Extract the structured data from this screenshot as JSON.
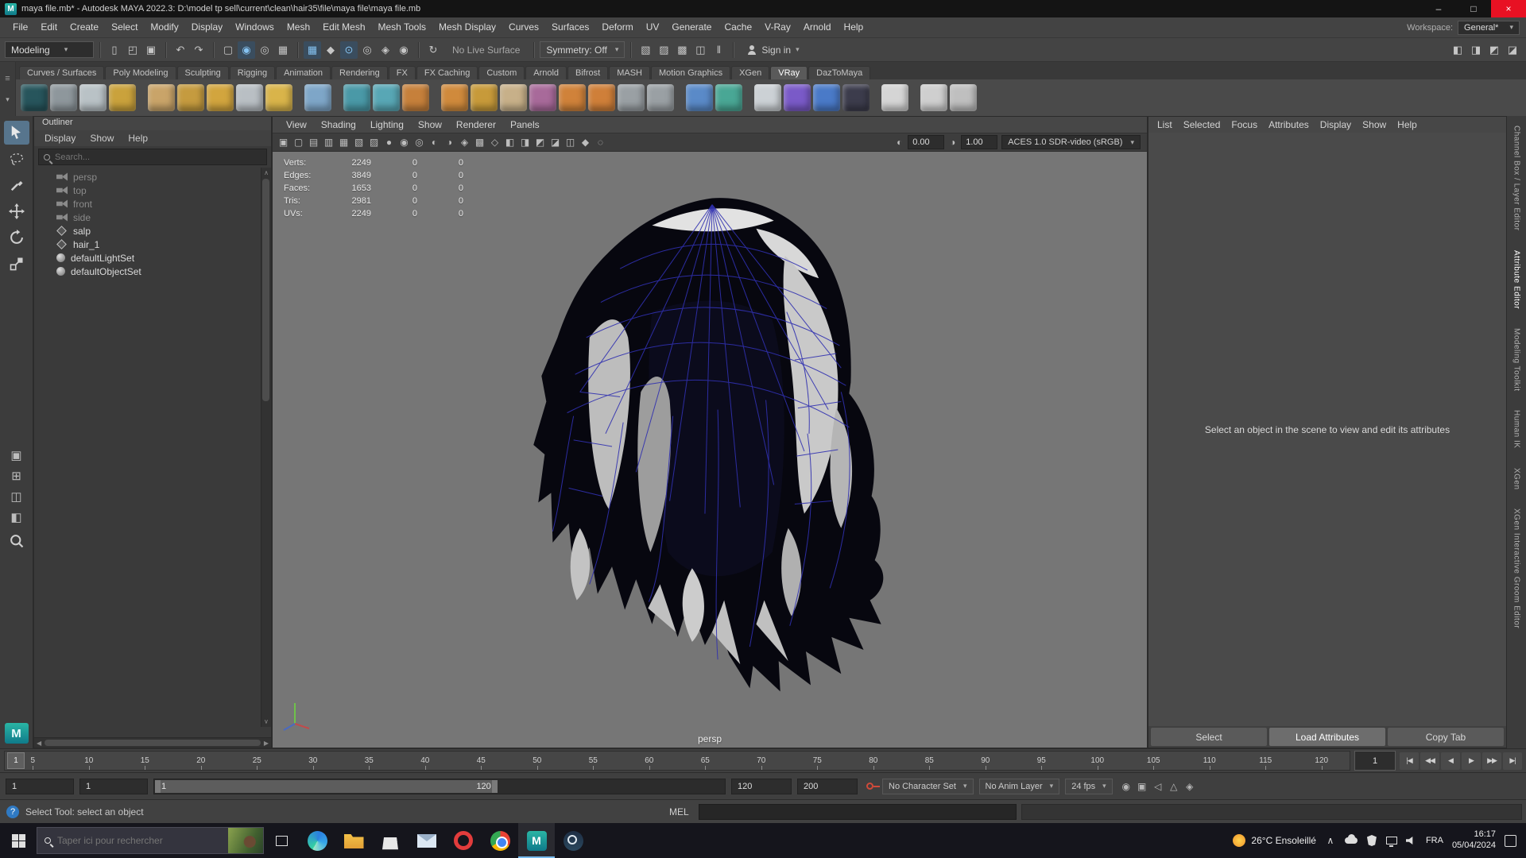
{
  "icons": {
    "chevron": "▾",
    "minimize": "–",
    "maximize": "□",
    "close": "×",
    "question": "?",
    "hamburger": "≡",
    "left_arrow": "◀",
    "right_arrow": "▶",
    "up_arrow": "∧"
  },
  "window": {
    "title": "maya file.mb* - Autodesk MAYA 2022.3: D:\\model tp sell\\current\\clean\\hair35\\file\\maya file\\maya file.mb"
  },
  "menu_bar": {
    "items": [
      "File",
      "Edit",
      "Create",
      "Select",
      "Modify",
      "Display",
      "Windows",
      "Mesh",
      "Edit Mesh",
      "Mesh Tools",
      "Mesh Display",
      "Curves",
      "Surfaces",
      "Deform",
      "UV",
      "Generate",
      "Cache",
      "V-Ray",
      "Arnold",
      "Help"
    ],
    "workspace_label": "Workspace:",
    "workspace_value": "General*"
  },
  "status_line": {
    "mode": "Modeling",
    "file_icons": [
      {
        "name": "new-scene-icon",
        "glyph": "▯"
      },
      {
        "name": "open-scene-icon",
        "glyph": "◰"
      },
      {
        "name": "save-scene-icon",
        "glyph": "▣"
      }
    ],
    "edit_icons": [
      {
        "name": "undo-icon",
        "glyph": "↶"
      },
      {
        "name": "redo-icon",
        "glyph": "↷"
      }
    ],
    "select_icons": [
      {
        "name": "select-hierarchy-icon",
        "glyph": "▢"
      },
      {
        "name": "select-object-icon",
        "glyph": "◉",
        "cls": "on"
      },
      {
        "name": "select-component-icon",
        "glyph": "◎"
      },
      {
        "name": "highlight-selection-icon",
        "glyph": "▦"
      }
    ],
    "snap_icons": [
      {
        "name": "snap-grid-icon",
        "glyph": "▦",
        "cls": "on"
      },
      {
        "name": "snap-curve-icon",
        "glyph": "◆"
      },
      {
        "name": "snap-point-icon",
        "glyph": "⊙",
        "cls": "on"
      },
      {
        "name": "snap-projected-center-icon",
        "glyph": "◎"
      },
      {
        "name": "snap-view-plane-icon",
        "glyph": "◈"
      },
      {
        "name": "make-live-icon",
        "glyph": "◉"
      }
    ],
    "history_icons": [
      {
        "name": "construction-history-icon",
        "glyph": "↻"
      }
    ],
    "no_live_surface": "No Live Surface",
    "symmetry": "Symmetry: Off",
    "render_icons": [
      {
        "name": "open-render-view-icon",
        "glyph": "▧"
      },
      {
        "name": "render-current-frame-icon",
        "glyph": "▨"
      },
      {
        "name": "ipr-render-icon",
        "glyph": "▩"
      },
      {
        "name": "render-settings-icon",
        "glyph": "◫"
      },
      {
        "name": "pause-viewport-icon",
        "glyph": "‖"
      }
    ],
    "sign_in": "Sign in",
    "ui_toggle_icons": [
      {
        "name": "single-pane-toggle-icon",
        "glyph": "◧"
      },
      {
        "name": "panel-layout-toggle-icon",
        "glyph": "◨"
      },
      {
        "name": "channel-box-toggle-icon",
        "glyph": "◩"
      },
      {
        "name": "attribute-editor-toggle-icon",
        "glyph": "◪"
      }
    ]
  },
  "shelf": {
    "tabs": [
      {
        "label": "Curves / Surfaces"
      },
      {
        "label": "Poly Modeling"
      },
      {
        "label": "Sculpting"
      },
      {
        "label": "Rigging"
      },
      {
        "label": "Animation"
      },
      {
        "label": "Rendering"
      },
      {
        "label": "FX"
      },
      {
        "label": "FX Caching"
      },
      {
        "label": "Custom"
      },
      {
        "label": "Arnold"
      },
      {
        "label": "Bifrost"
      },
      {
        "label": "MASH"
      },
      {
        "label": "Motion Graphics"
      },
      {
        "label": "XGen"
      },
      {
        "label": "VRay",
        "cls": "active"
      },
      {
        "label": "DazToMaya"
      }
    ],
    "icons": [
      {
        "name": "vray-sphere-dark-icon",
        "bg": "#27555c"
      },
      {
        "name": "vray-sphere-gray-icon",
        "bg": "#8e979c"
      },
      {
        "name": "vray-sphere-light-icon",
        "bg": "#b9c2c6"
      },
      {
        "name": "gold-lamp-icon",
        "bg": "#caa23c"
      },
      {
        "cls": "gap"
      },
      {
        "name": "umbrella-icon",
        "bg": "#c9a469"
      },
      {
        "name": "hammer-icon",
        "bg": "#c59b3f"
      },
      {
        "name": "gold-sphere-icon",
        "bg": "#d2a53e"
      },
      {
        "name": "atom-icon",
        "bg": "#b9bfc4"
      },
      {
        "name": "star-icon",
        "bg": "#d9b44a"
      },
      {
        "cls": "gap"
      },
      {
        "name": "glass-pane-icon",
        "bg": "#7ea6c8"
      },
      {
        "cls": "gap"
      },
      {
        "name": "export-proxy-icon",
        "bg": "#4a99a7"
      },
      {
        "name": "import-proxy-icon",
        "bg": "#58a7b5"
      },
      {
        "name": "scene-export-icon",
        "bg": "#c6803b"
      },
      {
        "cls": "gap"
      },
      {
        "name": "fur-icon",
        "bg": "#d08a3c"
      },
      {
        "name": "trident-icon",
        "bg": "#c79a3a"
      },
      {
        "name": "interactive-hand-icon",
        "bg": "#c7b089"
      },
      {
        "name": "texture-grid-icon",
        "bg": "#a86a9a"
      },
      {
        "name": "checker-icon",
        "bg": "#d0823a"
      },
      {
        "name": "orange-sphere-icon",
        "bg": "#cf7f39"
      },
      {
        "name": "rig-person-icon",
        "bg": "#9aa0a4"
      },
      {
        "name": "gear-icon",
        "bg": "#9aa0a4"
      },
      {
        "cls": "gap"
      },
      {
        "name": "blue-diamond-icon",
        "bg": "#5a8ac8"
      },
      {
        "name": "molecule-icon",
        "bg": "#49a795"
      },
      {
        "cls": "gap"
      },
      {
        "name": "vray-logo-sphere-icon",
        "bg": "#ccd1d5"
      },
      {
        "name": "vray-render-icon",
        "bg": "#7a5ac8"
      },
      {
        "name": "vray-dome-light-icon",
        "bg": "#4a7ac8"
      },
      {
        "name": "vray-material-icon",
        "bg": "#3c3c4c"
      },
      {
        "cls": "gap"
      },
      {
        "name": "node-graph-icon",
        "bg": "#d5d5d5"
      },
      {
        "cls": "gap"
      },
      {
        "name": "vr-ring-icon",
        "bg": "#cfcfcf"
      },
      {
        "name": "daz-logo-icon",
        "bg": "#bfbfbf"
      }
    ]
  },
  "toolbox": {
    "tools": [
      "select-tool",
      "lasso-tool",
      "paint-select-tool",
      "move-tool",
      "rotate-tool",
      "scale-tool"
    ],
    "layouts": [
      {
        "name": "single-pane-layout-icon",
        "glyph": "▣"
      },
      {
        "name": "four-pane-layout-icon",
        "glyph": "⊞"
      },
      {
        "name": "persp-outliner-layout-icon",
        "glyph": "◫"
      },
      {
        "name": "split-layout-icon",
        "glyph": "◧"
      }
    ]
  },
  "outliner": {
    "title": "Outliner",
    "menus": [
      "Display",
      "Show",
      "Help"
    ],
    "search_placeholder": "Search...",
    "items": [
      {
        "label": "persp",
        "cls": "camera muted"
      },
      {
        "label": "top",
        "cls": "camera muted"
      },
      {
        "label": "front",
        "cls": "camera muted"
      },
      {
        "label": "side",
        "cls": "camera muted"
      },
      {
        "label": "salp",
        "cls": "mesh"
      },
      {
        "label": "hair_1",
        "cls": "mesh"
      },
      {
        "label": "defaultLightSet",
        "cls": "set"
      },
      {
        "label": "defaultObjectSet",
        "cls": "set"
      }
    ]
  },
  "viewport": {
    "menus": [
      "View",
      "Shading",
      "Lighting",
      "Show",
      "Renderer",
      "Panels"
    ],
    "toolbar_icons": [
      {
        "name": "select-camera-icon",
        "glyph": "▣"
      },
      {
        "name": "lock-camera-icon",
        "glyph": "▢"
      },
      {
        "name": "camera-attributes-icon",
        "glyph": "▤"
      },
      {
        "name": "bookmark-icon",
        "glyph": "▥"
      },
      {
        "name": "image-plane-icon",
        "glyph": "▦"
      },
      {
        "name": "pan-zoom-icon",
        "glyph": "▧"
      },
      {
        "name": "wireframe-mode-icon",
        "glyph": "▨"
      },
      {
        "name": "smooth-shade-icon",
        "glyph": "●"
      },
      {
        "name": "textured-mode-icon",
        "glyph": "◉"
      },
      {
        "name": "use-lights-icon",
        "glyph": "◎"
      },
      {
        "name": "shadows-icon",
        "glyph": "◐"
      },
      {
        "name": "ambient-occlusion-icon",
        "glyph": "◑"
      },
      {
        "name": "motion-blur-icon",
        "glyph": "◈"
      },
      {
        "name": "multisample-icon",
        "glyph": "▩"
      },
      {
        "name": "isolate-select-icon",
        "glyph": "◇"
      },
      {
        "name": "field-chart-icon",
        "glyph": "◧"
      },
      {
        "name": "resolution-gate-icon",
        "glyph": "◨"
      },
      {
        "name": "gate-mask-icon",
        "glyph": "◩"
      },
      {
        "name": "safe-action-icon",
        "glyph": "◪"
      },
      {
        "name": "safe-title-icon",
        "glyph": "◫"
      },
      {
        "name": "hud-toggle-icon",
        "glyph": "◆"
      },
      {
        "name": "xray-icon",
        "glyph": "◌"
      }
    ],
    "exposure_icon": "◐",
    "exposure": "0.00",
    "gamma_icon": "◑",
    "gamma": "1.00",
    "colorspace": "ACES 1.0 SDR-video (sRGB)",
    "camera_label": "persp",
    "hud_rows": [
      {
        "label": "Verts:",
        "value": "2249",
        "col2": "0",
        "col3": "0"
      },
      {
        "label": "Edges:",
        "value": "3849",
        "col2": "0",
        "col3": "0"
      },
      {
        "label": "Faces:",
        "value": "1653",
        "col2": "0",
        "col3": "0"
      },
      {
        "label": "Tris:",
        "value": "2981",
        "col2": "0",
        "col3": "0"
      },
      {
        "label": "UVs:",
        "value": "2249",
        "col2": "0",
        "col3": "0"
      }
    ]
  },
  "attribute_editor": {
    "menus": [
      "List",
      "Selected",
      "Focus",
      "Attributes",
      "Display",
      "Show",
      "Help"
    ],
    "empty_message": "Select an object in the scene to view and edit its attributes",
    "buttons": [
      {
        "label": "Select"
      },
      {
        "label": "Load Attributes",
        "cls": "primary"
      },
      {
        "label": "Copy Tab"
      }
    ]
  },
  "right_tabs": [
    {
      "label": "Channel Box / Layer Editor"
    },
    {
      "label": "Attribute Editor",
      "cls": "active"
    },
    {
      "label": "Modeling Toolkit"
    },
    {
      "label": "Human IK"
    },
    {
      "label": "XGen"
    },
    {
      "label": "XGen Interactive Groom Editor"
    }
  ],
  "timeline": {
    "ticks": [
      "5",
      "10",
      "15",
      "20",
      "25",
      "30",
      "35",
      "40",
      "45",
      "50",
      "55",
      "60",
      "65",
      "70",
      "75",
      "80",
      "85",
      "90",
      "95",
      "100",
      "105",
      "110",
      "115",
      "120"
    ],
    "current_frame": "1",
    "current_frame_field": "1",
    "playback": [
      {
        "name": "go-to-start-button",
        "glyph": "|◀"
      },
      {
        "name": "step-back-button",
        "glyph": "◀◀"
      },
      {
        "name": "play-backwards-button",
        "glyph": "◀"
      },
      {
        "name": "play-button",
        "glyph": "▶"
      },
      {
        "name": "step-forward-button",
        "glyph": "▶▶"
      },
      {
        "name": "go-to-end-button",
        "glyph": "▶|"
      }
    ]
  },
  "range_slider": {
    "anim_start": "1",
    "playback_start": "1",
    "range_start": "1",
    "range_end": "120",
    "playback_end": "120",
    "anim_end": "200",
    "character_set": "No Character Set",
    "anim_layer": "No Anim Layer",
    "fps": "24 fps",
    "right_icons": [
      {
        "name": "mute-icon",
        "glyph": "◉"
      },
      {
        "name": "cache-icon",
        "glyph": "▣"
      },
      {
        "name": "sound-icon",
        "glyph": "◁"
      },
      {
        "name": "grease-pencil-icon",
        "glyph": "△"
      },
      {
        "name": "preferences-icon",
        "glyph": "◈"
      }
    ]
  },
  "command_line": {
    "mel_label": "MEL"
  },
  "help_line": {
    "text": "Select Tool: select an object"
  },
  "taskbar": {
    "search_placeholder": "Taper ici pour rechercher",
    "apps": [
      {
        "name": "edge-icon",
        "cls": "edge"
      },
      {
        "name": "file-explorer-icon",
        "cls": "explorer"
      },
      {
        "name": "store-icon",
        "cls": "store"
      },
      {
        "name": "mail-icon",
        "cls": "mail"
      },
      {
        "name": "opera-icon",
        "cls": "opera"
      },
      {
        "name": "chrome-icon",
        "cls": "chrome"
      },
      {
        "name": "maya-icon",
        "cls": "maya-app active",
        "glyph": "M"
      },
      {
        "name": "steam-icon",
        "cls": "steam"
      }
    ],
    "chrome_colors": [
      "#e84335",
      "#f7b705",
      "#34a853",
      "#4285f4"
    ],
    "maya_accent": "#1b9c8f",
    "tray": {
      "weather": "26°C Ensoleillé",
      "lang": "FRA",
      "time": "16:17",
      "date": "05/04/2024"
    }
  }
}
